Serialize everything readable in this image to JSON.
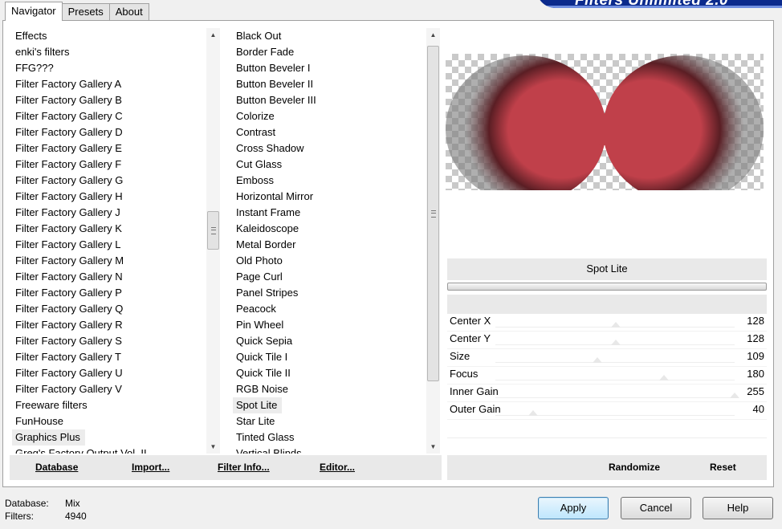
{
  "tabs": [
    "Navigator",
    "Presets",
    "About"
  ],
  "brand_title": "Filters Unlimited 2.0",
  "categories": [
    "Effects",
    "enki's filters",
    "FFG???",
    "Filter Factory Gallery A",
    "Filter Factory Gallery B",
    "Filter Factory Gallery C",
    "Filter Factory Gallery D",
    "Filter Factory Gallery E",
    "Filter Factory Gallery F",
    "Filter Factory Gallery G",
    "Filter Factory Gallery H",
    "Filter Factory Gallery J",
    "Filter Factory Gallery K",
    "Filter Factory Gallery L",
    "Filter Factory Gallery M",
    "Filter Factory Gallery N",
    "Filter Factory Gallery P",
    "Filter Factory Gallery Q",
    "Filter Factory Gallery R",
    "Filter Factory Gallery S",
    "Filter Factory Gallery T",
    "Filter Factory Gallery U",
    "Filter Factory Gallery V",
    "Freeware filters",
    "FunHouse",
    "Graphics Plus",
    "Greg's Factory Output Vol. II"
  ],
  "selected_category": "Graphics Plus",
  "filters": [
    "Black Out",
    "Border Fade",
    "Button Beveler I",
    "Button Beveler II",
    "Button Beveler III",
    "Colorize",
    "Contrast",
    "Cross Shadow",
    "Cut Glass",
    "Emboss",
    "Horizontal Mirror",
    "Instant Frame",
    "Kaleidoscope",
    "Metal Border",
    "Old Photo",
    "Page Curl",
    "Panel Stripes",
    "Peacock",
    "Pin Wheel",
    "Quick Sepia",
    "Quick Tile I",
    "Quick Tile II",
    "RGB Noise",
    "Spot Lite",
    "Star Lite",
    "Tinted Glass",
    "Vertical Blinds"
  ],
  "selected_filter": "Spot Lite",
  "left_buttons": {
    "database": "Database",
    "import": "Import...",
    "filter_info": "Filter Info...",
    "editor": "Editor..."
  },
  "filter_title": "Spot Lite",
  "params": [
    {
      "name": "Center X",
      "value": "128",
      "level": 128
    },
    {
      "name": "Center Y",
      "value": "128",
      "level": 128
    },
    {
      "name": "Size",
      "value": "109",
      "level": 109
    },
    {
      "name": "Focus",
      "value": "180",
      "level": 180
    },
    {
      "name": "Inner Gain",
      "value": "255",
      "level": 255
    },
    {
      "name": "Outer Gain",
      "value": "40",
      "level": 40
    }
  ],
  "right_buttons": {
    "randomize": "Randomize",
    "reset": "Reset"
  },
  "status": {
    "database_label": "Database:",
    "database_value": "Mix",
    "filters_label": "Filters:",
    "filters_value": "4940"
  },
  "dialog_buttons": {
    "apply": "Apply",
    "cancel": "Cancel",
    "help": "Help"
  },
  "colors": {
    "preview_red": "#c0404a",
    "brand_blue": "#0b2a8c"
  }
}
